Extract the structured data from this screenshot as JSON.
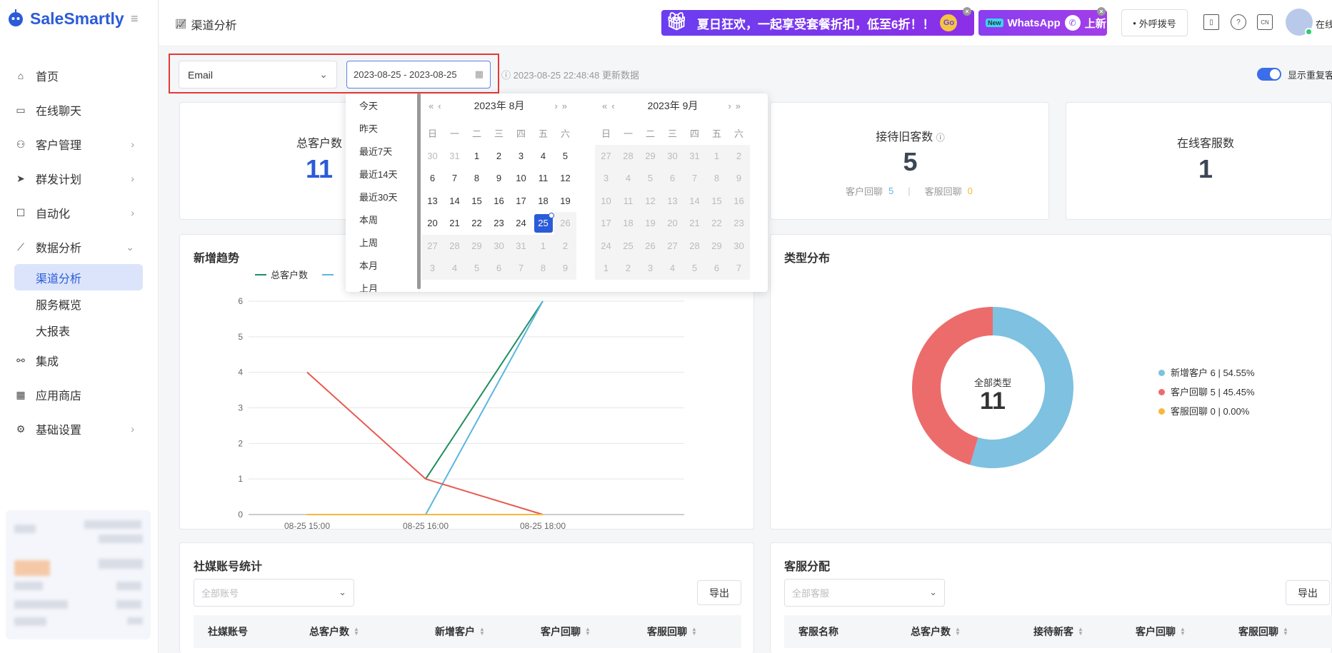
{
  "app": {
    "name": "SaleSmartly"
  },
  "sidebar": {
    "items": [
      {
        "label": "首页",
        "icon": "home-icon"
      },
      {
        "label": "在线聊天",
        "icon": "chat-icon"
      },
      {
        "label": "客户管理",
        "icon": "users-icon"
      },
      {
        "label": "群发计划",
        "icon": "send-icon"
      },
      {
        "label": "自动化",
        "icon": "robot-icon"
      },
      {
        "label": "数据分析",
        "icon": "chart-icon"
      },
      {
        "label": "集成",
        "icon": "integration-icon"
      },
      {
        "label": "应用商店",
        "icon": "apps-icon"
      },
      {
        "label": "基础设置",
        "icon": "settings-icon"
      }
    ],
    "sub_items": [
      "渠道分析",
      "服务概览",
      "大报表"
    ]
  },
  "header": {
    "page_title": "渠道分析",
    "promo_banner": "夏日狂欢，一起享受套餐折扣，低至6折！！",
    "promo_go": "Go",
    "whatsapp_new": "New",
    "whatsapp_text": "WhatsApp",
    "whatsapp_suffix": "上新",
    "dial_button": "外呼拨号",
    "lang": "CN",
    "user_status": "在线"
  },
  "toolbar": {
    "channel": "Email",
    "date_range": "2023-08-25 - 2023-08-25",
    "update_text": "2023-08-25 22:48:48 更新数据",
    "toggle_label": "显示重复客户"
  },
  "kpis": {
    "total_customers_label": "总客户数",
    "total_customers": "11",
    "old_customers_label": "接待旧客数",
    "old_customers": "5",
    "customer_reply_label": "客户回聊",
    "customer_reply": "5",
    "agent_reply_label": "客服回聊",
    "agent_reply": "0",
    "online_agents_label": "在线客服数",
    "online_agents": "1"
  },
  "datepicker": {
    "shortcuts": [
      "今天",
      "昨天",
      "最近7天",
      "最近14天",
      "最近30天",
      "本周",
      "上周",
      "本月",
      "上月"
    ],
    "weekdays": [
      "日",
      "一",
      "二",
      "三",
      "四",
      "五",
      "六"
    ],
    "left_month": "2023年 8月",
    "right_month": "2023年 9月",
    "selected_day": "25"
  },
  "trend": {
    "title": "新增趋势",
    "legend_total": "总客户数"
  },
  "chart_data": [
    {
      "type": "line",
      "title": "新增趋势",
      "x": [
        "08-25 15:00",
        "08-25 16:00",
        "08-25 18:00"
      ],
      "ylim": [
        0,
        6
      ],
      "yticks": [
        0,
        1,
        2,
        3,
        4,
        5,
        6
      ],
      "series": [
        {
          "name": "总客户数",
          "color": "#1f8f5f",
          "values": [
            null,
            1,
            6
          ]
        },
        {
          "color": "#5bb6e0",
          "values": [
            null,
            0,
            6
          ]
        },
        {
          "color": "#e8594f",
          "values": [
            4,
            1,
            0
          ]
        },
        {
          "color": "#f5b93a",
          "values": [
            0,
            0,
            0
          ]
        }
      ]
    },
    {
      "type": "pie",
      "title": "类型分布",
      "center_label": "全部类型",
      "center_value": "11",
      "slices": [
        {
          "name": "新增客户",
          "value": 6,
          "percent": "54.55%",
          "color": "#7ec1e0"
        },
        {
          "name": "客户回聊",
          "value": 5,
          "percent": "45.45%",
          "color": "#ec6c6c"
        },
        {
          "name": "客服回聊",
          "value": 0,
          "percent": "0.00%",
          "color": "#f5b93a"
        }
      ]
    }
  ],
  "donut": {
    "title": "类型分布",
    "center_label": "全部类型",
    "center_value": "11",
    "legend": [
      "新增客户 6 | 54.55%",
      "客户回聊 5 | 45.45%",
      "客服回聊 0 | 0.00%"
    ]
  },
  "social_table": {
    "title": "社媒账号统计",
    "filter_placeholder": "全部账号",
    "export": "导出",
    "columns": [
      "社媒账号",
      "总客户数",
      "新增客户",
      "客户回聊",
      "客服回聊"
    ]
  },
  "agent_table": {
    "title": "客服分配",
    "filter_placeholder": "全部客服",
    "export": "导出",
    "columns": [
      "客服名称",
      "总客户数",
      "接待新客",
      "客户回聊",
      "客服回聊"
    ]
  }
}
